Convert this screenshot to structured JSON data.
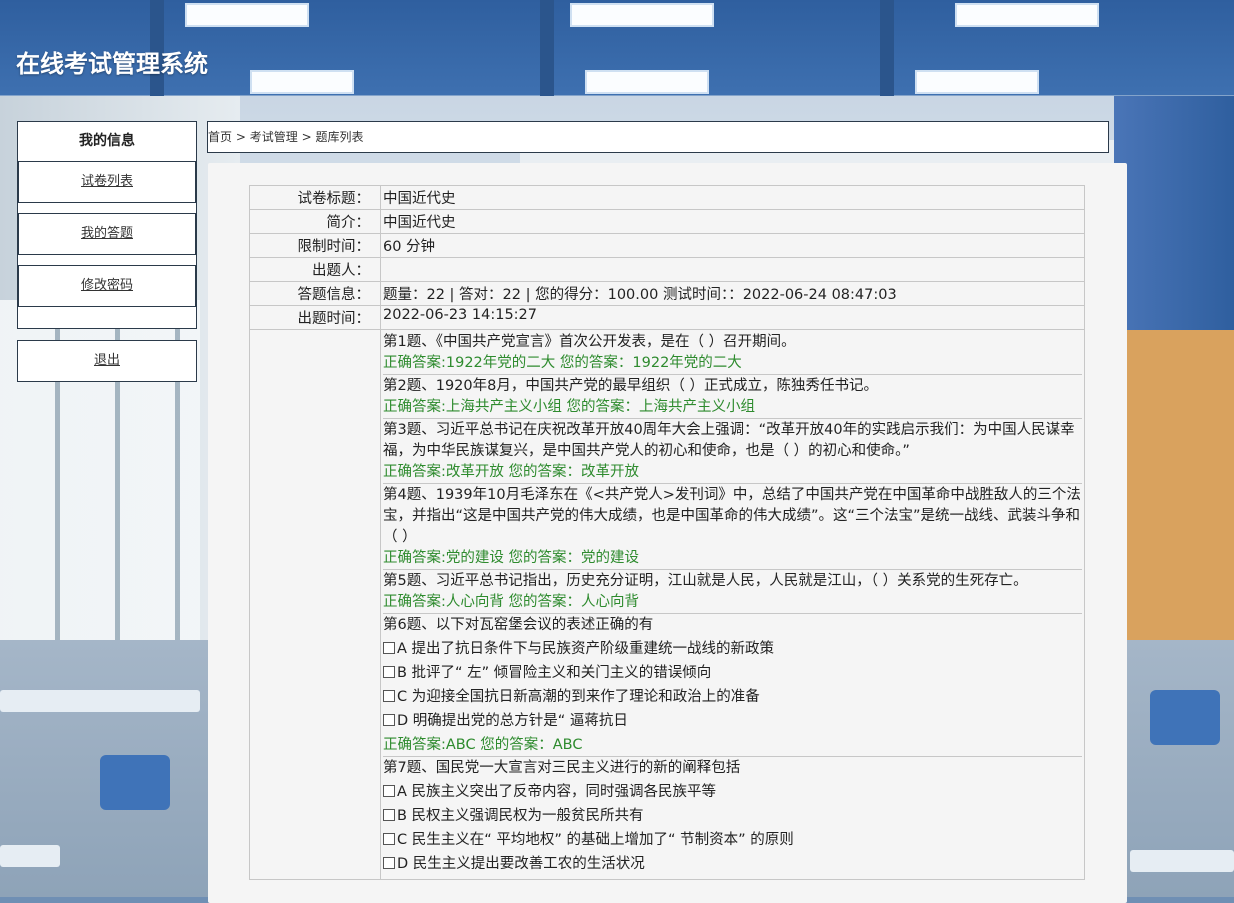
{
  "app_title": "在线考试管理系统",
  "sidebar": {
    "header": "我的信息",
    "items": [
      {
        "label": "试卷列表"
      },
      {
        "label": "我的答题"
      },
      {
        "label": "修改密码"
      }
    ],
    "logout": "退出"
  },
  "breadcrumb": {
    "home": "首页",
    "sep": ">",
    "exam_mgmt": "考试管理",
    "current": "题库列表"
  },
  "exam": {
    "title_label": "试卷标题：",
    "title": "中国近代史",
    "intro_label": "简介：",
    "intro": "中国近代史",
    "time_label": "限制时间：",
    "time": "60 分钟",
    "author_label": "出题人：",
    "author": "",
    "answer_info_label": "答题信息：",
    "answer_info": "题量：22 | 答对：22 | 您的得分：100.00 测试时间：：2022-06-24 08:47:03",
    "created_label": "出题时间：",
    "created": "2022-06-23 14:15:27"
  },
  "questions": [
    {
      "text": "第1题、《中国共产党宣言》首次公开发表，是在（ ）召开期间。",
      "answer": "正确答案:1922年党的二大 您的答案：1922年党的二大"
    },
    {
      "text": "第2题、1920年8月，中国共产党的最早组织（ ）正式成立，陈独秀任书记。",
      "answer": "正确答案:上海共产主义小组 您的答案：上海共产主义小组"
    },
    {
      "text": "第3题、习近平总书记在庆祝改革开放40周年大会上强调：“改革开放40年的实践启示我们：为中国人民谋幸福，为中华民族谋复兴，是中国共产党人的初心和使命，也是（ ）的初心和使命。”",
      "answer": "正确答案:改革开放 您的答案：改革开放"
    },
    {
      "text": "第4题、1939年10月毛泽东在《<共产党人>发刊词》中，总结了中国共产党在中国革命中战胜敌人的三个法宝，并指出“这是中国共产党的伟大成绩，也是中国革命的伟大成绩”。这“三个法宝”是统一战线、武装斗争和（ ）",
      "answer": "正确答案:党的建设 您的答案：党的建设"
    },
    {
      "text": "第5题、习近平总书记指出，历史充分证明，江山就是人民，人民就是江山，（ ）关系党的生死存亡。",
      "answer": "正确答案:人心向背 您的答案：人心向背"
    },
    {
      "text": "第6题、以下对瓦窑堡会议的表述正确的有",
      "options": [
        "A 提出了抗日条件下与民族资产阶级重建统一战线的新政策",
        "B 批评了“ 左” 倾冒险主义和关门主义的错误倾向",
        "C 为迎接全国抗日新高潮的到来作了理论和政治上的准备",
        "D 明确提出党的总方针是“ 逼蒋抗日"
      ],
      "answer": "正确答案:ABC 您的答案：ABC"
    },
    {
      "text": "第7题、国民党一大宣言对三民主义进行的新的阐释包括",
      "options": [
        "A 民族主义突出了反帝内容，同时强调各民族平等",
        "B 民权主义强调民权为一般贫民所共有",
        "C 民生主义在“ 平均地权” 的基础上增加了“ 节制资本” 的原则",
        "D 民生主义提出要改善工农的生活状况"
      ],
      "answer": ""
    }
  ]
}
